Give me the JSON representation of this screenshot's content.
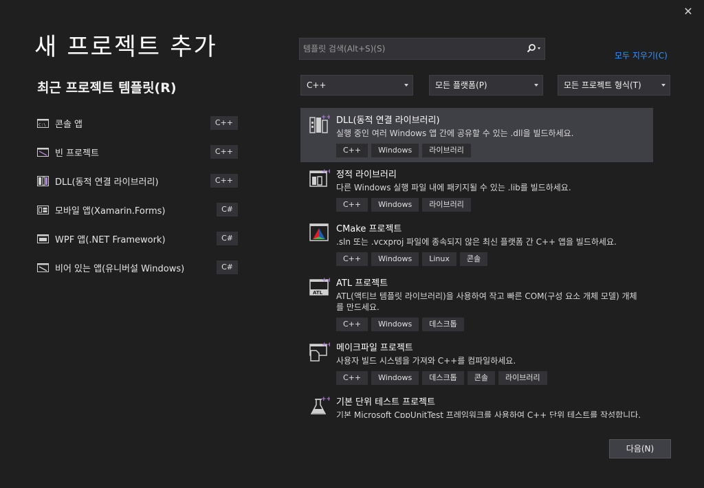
{
  "dialog": {
    "title": "새 프로젝트 추가",
    "close_glyph": "✕",
    "next_label": "다음(N)"
  },
  "recent": {
    "title": "최근 프로젝트 템플릿(R)",
    "items": [
      {
        "label": "콘솔 앱",
        "lang": "C++",
        "icon": "console-app-icon"
      },
      {
        "label": "빈 프로젝트",
        "lang": "C++",
        "icon": "empty-project-icon"
      },
      {
        "label": "DLL(동적 연결 라이브러리)",
        "lang": "C++",
        "icon": "dll-icon"
      },
      {
        "label": "모바일 앱(Xamarin.Forms)",
        "lang": "C#",
        "icon": "mobile-app-icon"
      },
      {
        "label": "WPF 앱(.NET Framework)",
        "lang": "C#",
        "icon": "wpf-app-icon"
      },
      {
        "label": "비어 있는 앱(유니버설 Windows)",
        "lang": "C#",
        "icon": "blank-uwp-app-icon"
      }
    ]
  },
  "search": {
    "placeholder": "템플릿 검색(Alt+S)(S)",
    "clear_all": "모두 지우기(C)"
  },
  "filters": {
    "language": "C++",
    "platform": "모든 플랫폼(P)",
    "project_type": "모든 프로젝트 형식(T)"
  },
  "templates": [
    {
      "name": "DLL(동적 연결 라이브러리)",
      "desc": "실행 중인 여러 Windows 앱 간에 공유할 수 있는 .dll을 빌드하세요.",
      "tags": [
        "C++",
        "Windows",
        "라이브러리"
      ],
      "icon": "dll-icon",
      "selected": true
    },
    {
      "name": "정적 라이브러리",
      "desc": "다른 Windows 실행 파일 내에 패키지될 수 있는 .lib를 빌드하세요.",
      "tags": [
        "C++",
        "Windows",
        "라이브러리"
      ],
      "icon": "static-library-icon"
    },
    {
      "name": "CMake 프로젝트",
      "desc": ".sln 또는 .vcxproj 파일에 종속되지 않은 최신 플랫폼 간 C++ 앱을 빌드하세요.",
      "tags": [
        "C++",
        "Windows",
        "Linux",
        "콘솔"
      ],
      "icon": "cmake-icon"
    },
    {
      "name": "ATL 프로젝트",
      "desc": "ATL(액티브 템플릿 라이브러리)을 사용하여 작고 빠른 COM(구성 요소 개체 모델) 개체를 만드세요.",
      "tags": [
        "C++",
        "Windows",
        "데스크톱"
      ],
      "icon": "atl-icon"
    },
    {
      "name": "메이크파일 프로젝트",
      "desc": "사용자 빌드 시스템을 가져와 C++를 컴파일하세요.",
      "tags": [
        "C++",
        "Windows",
        "데스크톱",
        "콘솔",
        "라이브러리"
      ],
      "icon": "makefile-icon"
    },
    {
      "name": "기본 단위 테스트 프로젝트",
      "desc": "기본 Microsoft CppUnitTest 프레임워크를 사용하여 C++ 단위 테스트를 작성합니다.",
      "tags": [],
      "icon": "unit-test-icon"
    }
  ],
  "colors": {
    "background": "#1f1f1f",
    "selected_row": "#3f3f46",
    "link": "#3794ff",
    "icon_purple": "#b180d7"
  }
}
